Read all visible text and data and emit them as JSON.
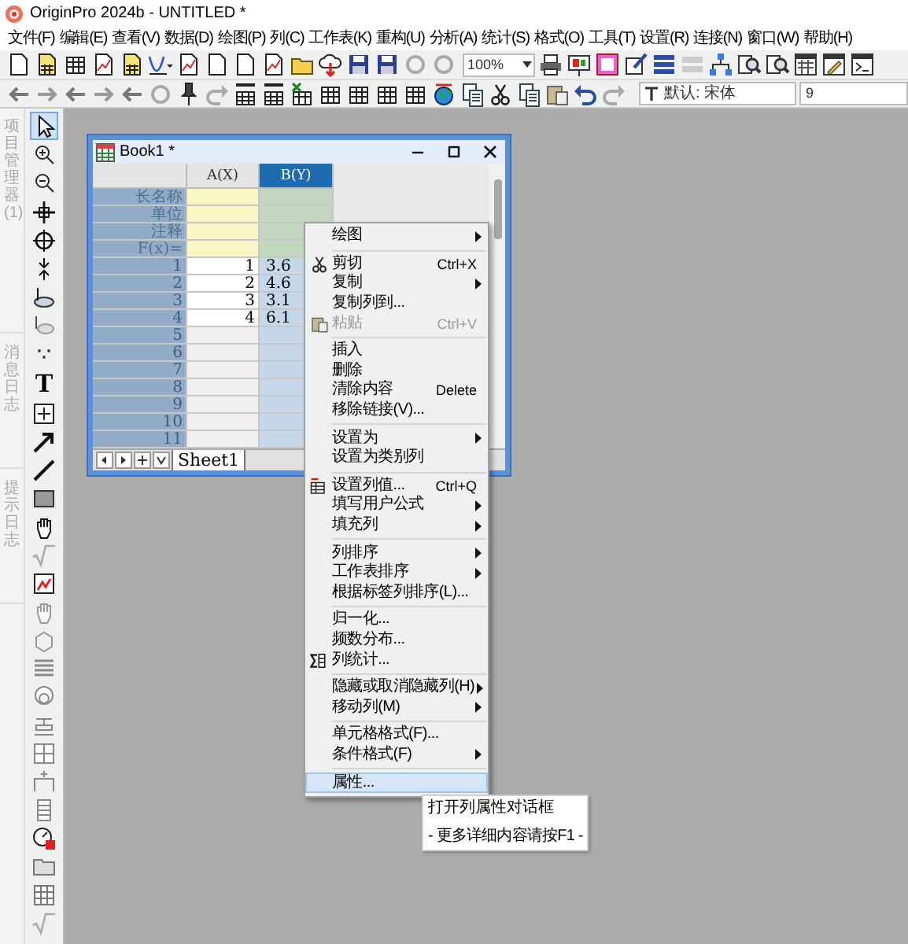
{
  "app": {
    "title": "OriginPro 2024b - UNTITLED *"
  },
  "menu_bar": [
    "文件(F)",
    "编辑(E)",
    "查看(V)",
    "数据(D)",
    "绘图(P)",
    "列(C)",
    "工作表(K)",
    "重构(U)",
    "分析(A)",
    "统计(S)",
    "格式(O)",
    "工具(T)",
    "设置(R)",
    "连接(N)",
    "窗口(W)",
    "帮助(H)"
  ],
  "toolbar": {
    "zoom": "100%",
    "font": "默认: 宋体",
    "font_size": "9"
  },
  "side_tabs": [
    "项目管理器 (1)",
    "消息日志",
    "提示日志"
  ],
  "tools": {
    "text_tool": "T"
  },
  "workbook": {
    "title": "Book1 *",
    "columns": [
      {
        "label": "A(X)",
        "selected": false
      },
      {
        "label": "B(Y)",
        "selected": true
      }
    ],
    "label_rows": [
      "长名称",
      "单位",
      "注释",
      "F(x)="
    ],
    "rows": [
      {
        "index": "1",
        "cells": [
          "1",
          "3.6"
        ]
      },
      {
        "index": "2",
        "cells": [
          "2",
          "4.6"
        ]
      },
      {
        "index": "3",
        "cells": [
          "3",
          "3.1"
        ]
      },
      {
        "index": "4",
        "cells": [
          "4",
          "6.1"
        ]
      },
      {
        "index": "5",
        "cells": []
      },
      {
        "index": "6",
        "cells": []
      },
      {
        "index": "7",
        "cells": []
      },
      {
        "index": "8",
        "cells": []
      },
      {
        "index": "9",
        "cells": []
      },
      {
        "index": "10",
        "cells": []
      },
      {
        "index": "11",
        "cells": []
      }
    ],
    "sheet_tab": "Sheet1"
  },
  "context_menu": [
    {
      "kind": "item",
      "label": "绘图",
      "submenu": true,
      "disabled": false,
      "selected": false
    },
    {
      "kind": "separator"
    },
    {
      "kind": "item",
      "label": "剪切",
      "shortcut": "Ctrl+X",
      "submenu": false,
      "disabled": false,
      "selected": false
    },
    {
      "kind": "item",
      "label": "复制",
      "submenu": true,
      "disabled": false,
      "selected": false
    },
    {
      "kind": "item",
      "label": "复制列到...",
      "submenu": false,
      "disabled": false,
      "selected": false
    },
    {
      "kind": "item",
      "label": "粘贴",
      "shortcut": "Ctrl+V",
      "submenu": false,
      "disabled": true,
      "selected": false
    },
    {
      "kind": "separator"
    },
    {
      "kind": "item",
      "label": "插入",
      "submenu": false,
      "disabled": false,
      "selected": false
    },
    {
      "kind": "item",
      "label": "删除",
      "submenu": false,
      "disabled": false,
      "selected": false
    },
    {
      "kind": "item",
      "label": "清除内容",
      "shortcut": "Delete",
      "submenu": false,
      "disabled": false,
      "selected": false
    },
    {
      "kind": "item",
      "label": "移除链接(V)...",
      "submenu": false,
      "disabled": false,
      "selected": false
    },
    {
      "kind": "separator"
    },
    {
      "kind": "item",
      "label": "设置为",
      "submenu": true,
      "disabled": false,
      "selected": false
    },
    {
      "kind": "item",
      "label": "设置为类别列",
      "submenu": false,
      "disabled": false,
      "selected": false
    },
    {
      "kind": "separator"
    },
    {
      "kind": "item",
      "label": "设置列值...",
      "shortcut": "Ctrl+Q",
      "submenu": false,
      "disabled": false,
      "selected": false
    },
    {
      "kind": "item",
      "label": "填写用户公式",
      "submenu": true,
      "disabled": false,
      "selected": false
    },
    {
      "kind": "item",
      "label": "填充列",
      "submenu": true,
      "disabled": false,
      "selected": false
    },
    {
      "kind": "separator"
    },
    {
      "kind": "item",
      "label": "列排序",
      "submenu": true,
      "disabled": false,
      "selected": false
    },
    {
      "kind": "item",
      "label": "工作表排序",
      "submenu": true,
      "disabled": false,
      "selected": false
    },
    {
      "kind": "item",
      "label": "根据标签列排序(L)...",
      "submenu": false,
      "disabled": false,
      "selected": false
    },
    {
      "kind": "separator"
    },
    {
      "kind": "item",
      "label": "归一化...",
      "submenu": false,
      "disabled": false,
      "selected": false
    },
    {
      "kind": "item",
      "label": "频数分布...",
      "submenu": false,
      "disabled": false,
      "selected": false
    },
    {
      "kind": "item",
      "label": "列统计...",
      "submenu": false,
      "disabled": false,
      "selected": false
    },
    {
      "kind": "separator"
    },
    {
      "kind": "item",
      "label": "隐藏或取消隐藏列(H)",
      "submenu": true,
      "disabled": false,
      "selected": false
    },
    {
      "kind": "item",
      "label": "移动列(M)",
      "submenu": true,
      "disabled": false,
      "selected": false
    },
    {
      "kind": "separator"
    },
    {
      "kind": "item",
      "label": "单元格格式(F)...",
      "submenu": false,
      "disabled": false,
      "selected": false
    },
    {
      "kind": "item",
      "label": "条件格式(F)",
      "submenu": true,
      "disabled": false,
      "selected": false
    },
    {
      "kind": "separator"
    },
    {
      "kind": "item",
      "label": "属性...",
      "submenu": false,
      "disabled": false,
      "selected": true
    }
  ],
  "tooltip": {
    "title": "打开列属性对话框",
    "hint": "- 更多详细内容请按F1 -"
  }
}
